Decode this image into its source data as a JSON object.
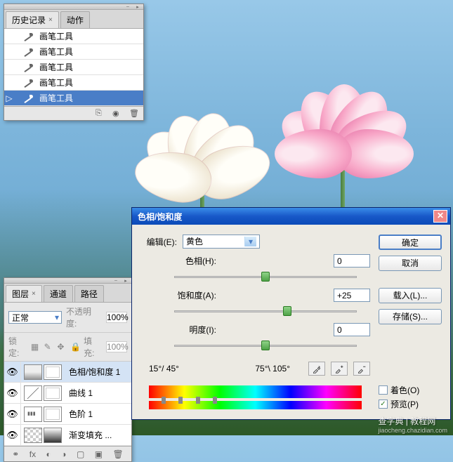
{
  "history_panel": {
    "tab_history": "历史记录",
    "tab_actions": "动作",
    "items": [
      {
        "label": "画笔工具"
      },
      {
        "label": "画笔工具"
      },
      {
        "label": "画笔工具"
      },
      {
        "label": "画笔工具"
      },
      {
        "label": "画笔工具"
      }
    ]
  },
  "layers_panel": {
    "tab_layers": "图层",
    "tab_channels": "通道",
    "tab_paths": "路径",
    "blend_mode": "正常",
    "opacity_label": "不透明度:",
    "opacity_value": "100%",
    "lock_label": "锁定:",
    "fill_label": "填充:",
    "fill_value": "100%",
    "layers": [
      {
        "name": "色相/饱和度 1"
      },
      {
        "name": "曲线 1"
      },
      {
        "name": "色阶 1"
      },
      {
        "name": "渐变填充 ..."
      }
    ]
  },
  "dialog": {
    "title": "色相/饱和度",
    "edit_label": "编辑(E):",
    "edit_value": "黄色",
    "hue_label": "色相(H):",
    "hue_value": "0",
    "sat_label": "饱和度(A):",
    "sat_value": "+25",
    "light_label": "明度(I):",
    "light_value": "0",
    "angle1": "15°/ 45°",
    "angle2": "75°\\ 105°",
    "ok": "确定",
    "cancel": "取消",
    "load": "载入(L)...",
    "save": "存储(S)...",
    "colorize": "着色(O)",
    "preview": "预览(P)"
  },
  "watermark": {
    "main": "查字典 | 教程网",
    "sub": "jiaocheng.chazidian.com"
  }
}
